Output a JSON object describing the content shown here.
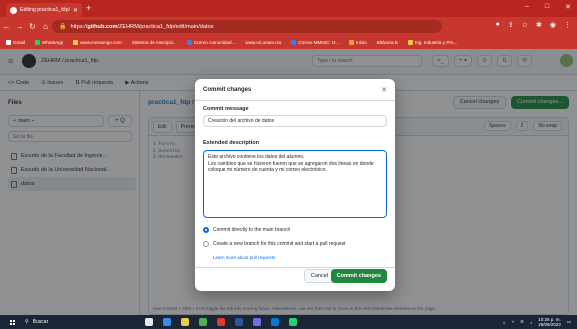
{
  "browser": {
    "tab_title": "Editing practica1_fdp/datos at m",
    "url_prefix": "https://",
    "url_host": "github.com",
    "url_path": "/ZEHRM/practica1_fdp/edit/main/datos",
    "bookmarks": [
      "Gmail",
      "WhatsApp",
      "www.meraongo.com",
      "Sistema de Inscripci...",
      "Correo comunidad...",
      "www.mi.unam.mx",
      "Correo MMNIC: H...",
      "Inicio",
      "Bitácora E",
      "Ing. Industria y Pro..."
    ]
  },
  "github": {
    "breadcrumb": "ZEHRM / practica1_fdp",
    "search_placeholder": "Type / to search",
    "repo_nav": [
      "Code",
      "Issues",
      "Pull requests",
      "Actions"
    ],
    "sidebar": {
      "title": "Files",
      "branch": "main",
      "go_to_file": "Go to file",
      "items": [
        "Escudo de la Facultad de Ingenie...",
        "Escudo de la Universidad Nacional...",
        "datos"
      ]
    },
    "editor": {
      "breadcrumb": "practica1_fdp /",
      "cancel_label": "Cancel changes",
      "commit_label": "Commit changes...",
      "tab_edit": "Edit",
      "tab_preview": "Preview",
      "spaces": "Spaces",
      "indent": "2",
      "wrap": "No wrap",
      "lines": [
        "1  Forero,",
        "2  Gonzalez",
        "3  Hernandez"
      ],
      "hint": "Use Control + Shift + m to toggle the tab key moving focus. Alternatively, use esc then tab to move to the next interactive element on the page."
    }
  },
  "modal": {
    "title": "Commit changes",
    "commit_message_label": "Commit message",
    "commit_message_value": "Creación del archivo de datos",
    "extended_label": "Extended description",
    "extended_value": "Este archivo contiene los datos del alumno.\nLos cambios que se hicieron fueron que se agregaron dos lineas en donde coloque mi número de cuenta y mi correo electrónico.",
    "option_direct": "Commit directly to the main branch",
    "option_new_branch": "Create a new branch for this commit and start a pull request",
    "learn_more": "Learn more about pull requests",
    "cancel": "Cancel",
    "commit": "Commit changes"
  },
  "taskbar": {
    "search": "Buscar",
    "time": "10:28 p. m.",
    "date": "28/06/2023"
  },
  "colors": {
    "chrome_red": "#c8372e",
    "primary_green": "#1f883d",
    "focus_blue": "#0969da"
  }
}
